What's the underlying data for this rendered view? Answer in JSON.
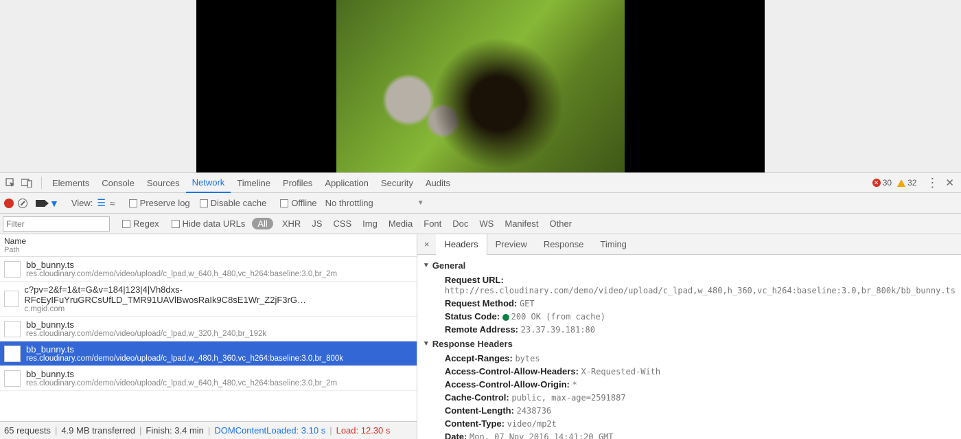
{
  "tabs": {
    "elements": "Elements",
    "console": "Console",
    "sources": "Sources",
    "network": "Network",
    "timeline": "Timeline",
    "profiles": "Profiles",
    "application": "Application",
    "security": "Security",
    "audits": "Audits"
  },
  "errors": {
    "err": "30",
    "warn": "32"
  },
  "toolbar": {
    "view": "View:",
    "preserve": "Preserve log",
    "disable": "Disable cache",
    "offline": "Offline",
    "throttling": "No throttling"
  },
  "filter": {
    "placeholder": "Filter",
    "regex": "Regex",
    "hide": "Hide data URLs",
    "types": {
      "all": "All",
      "xhr": "XHR",
      "js": "JS",
      "css": "CSS",
      "img": "Img",
      "media": "Media",
      "font": "Font",
      "doc": "Doc",
      "ws": "WS",
      "manifest": "Manifest",
      "other": "Other"
    }
  },
  "colhdr": {
    "name": "Name",
    "path": "Path"
  },
  "rows": [
    {
      "name": "bb_bunny.ts",
      "path": "res.cloudinary.com/demo/video/upload/c_lpad,w_640,h_480,vc_h264:baseline:3.0,br_2m"
    },
    {
      "name": "c?pv=2&f=1&t=G&v=184|123|4|Vh8dxs-RFcEyIFuYruGRCsUfLD_TMR91UAVlBwosRaIk9C8sE1Wr_Z2jF3rG…",
      "path": "c.mgid.com"
    },
    {
      "name": "bb_bunny.ts",
      "path": "res.cloudinary.com/demo/video/upload/c_lpad,w_320,h_240,br_192k"
    },
    {
      "name": "bb_bunny.ts",
      "path": "res.cloudinary.com/demo/video/upload/c_lpad,w_480,h_360,vc_h264:baseline:3.0,br_800k"
    },
    {
      "name": "bb_bunny.ts",
      "path": "res.cloudinary.com/demo/video/upload/c_lpad,w_640,h_480,vc_h264:baseline:3.0,br_2m"
    }
  ],
  "status": {
    "requests": "65 requests",
    "transferred": "4.9 MB transferred",
    "finish": "Finish: 3.4 min",
    "dcl": "DOMContentLoaded: 3.10 s",
    "load": "Load: 12.30 s"
  },
  "detailtabs": {
    "headers": "Headers",
    "preview": "Preview",
    "response": "Response",
    "timing": "Timing"
  },
  "general": {
    "title": "General",
    "url_k": "Request URL:",
    "url_v": "http://res.cloudinary.com/demo/video/upload/c_lpad,w_480,h_360,vc_h264:baseline:3.0,br_800k/bb_bunny.ts",
    "method_k": "Request Method:",
    "method_v": "GET",
    "status_k": "Status Code:",
    "status_v": "200 OK (from cache)",
    "remote_k": "Remote Address:",
    "remote_v": "23.37.39.181:80"
  },
  "resp": {
    "title": "Response Headers",
    "ar_k": "Accept-Ranges:",
    "ar_v": "bytes",
    "ach_k": "Access-Control-Allow-Headers:",
    "ach_v": "X-Requested-With",
    "aco_k": "Access-Control-Allow-Origin:",
    "aco_v": "*",
    "cc_k": "Cache-Control:",
    "cc_v": "public, max-age=2591887",
    "cl_k": "Content-Length:",
    "cl_v": "2438736",
    "ct_k": "Content-Type:",
    "ct_v": "video/mp2t",
    "dt_k": "Date:",
    "dt_v": "Mon, 07 Nov 2016 14:41:20 GMT"
  }
}
